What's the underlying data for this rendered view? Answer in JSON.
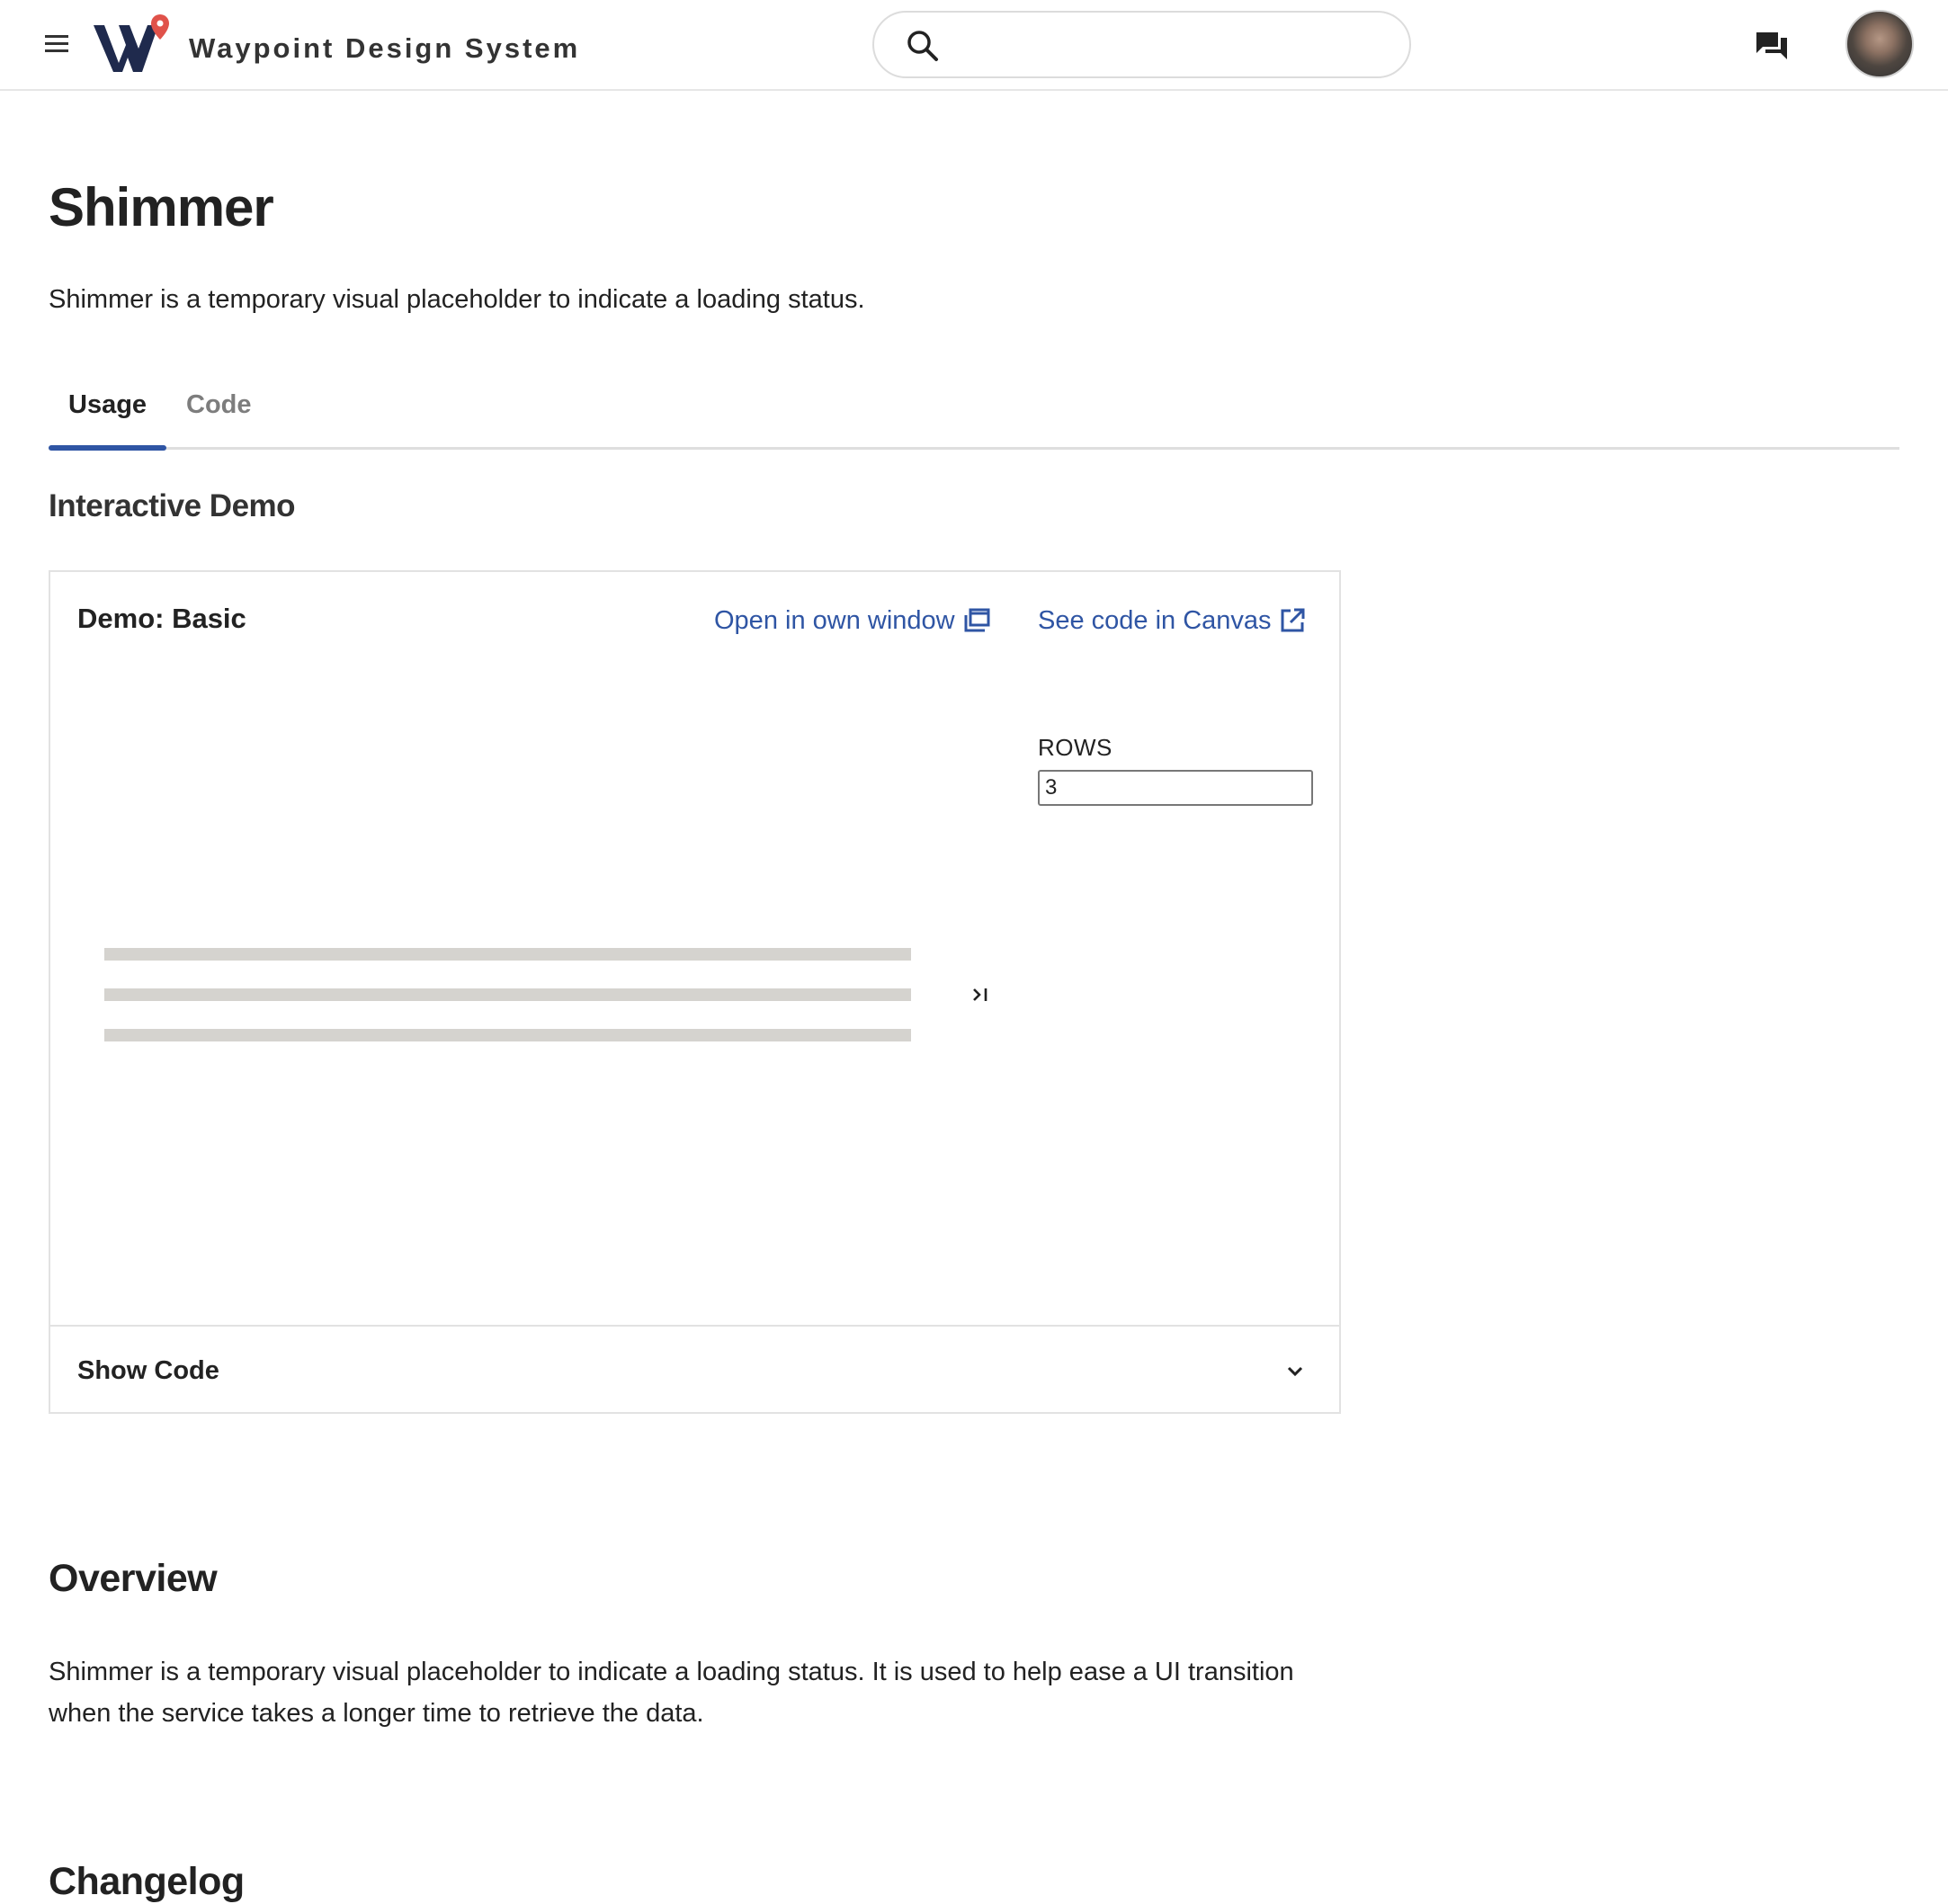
{
  "header": {
    "brand_name": "Waypoint Design System",
    "search": {
      "value": "",
      "placeholder": ""
    }
  },
  "page": {
    "title": "Shimmer",
    "intro": "Shimmer is a temporary visual placeholder to indicate a loading status."
  },
  "tabs": [
    {
      "label": "Usage",
      "selected": true
    },
    {
      "label": "Code",
      "selected": false
    }
  ],
  "interactive_demo": {
    "heading": "Interactive Demo",
    "card": {
      "title": "Demo: Basic",
      "open_window_label": "Open in own window",
      "see_code_label": "See code in Canvas",
      "rows_label": "ROWS",
      "rows_value": "3",
      "shimmer_rows": 3,
      "show_code_label": "Show Code"
    }
  },
  "overview": {
    "heading": "Overview",
    "text": "Shimmer is a temporary visual placeholder to indicate a loading status. It is used to help ease a UI transition when the service takes a longer time to retrieve the data."
  },
  "changelog": {
    "heading": "Changelog"
  },
  "icons": {
    "menu": "hamburger-menu-icon",
    "search": "search-icon",
    "chat": "chat-bubbles-icon",
    "open_window": "open-in-window-icon",
    "external_link": "external-link-icon",
    "collapse": "collapse-panel-icon",
    "chevron": "chevron-down-icon"
  },
  "colors": {
    "accent": "#2f55a4",
    "logo_navy": "#1f2a4d",
    "logo_pin": "#e0524a",
    "shimmer": "#d5d3cf",
    "muted_text": "#7d7d7d"
  }
}
